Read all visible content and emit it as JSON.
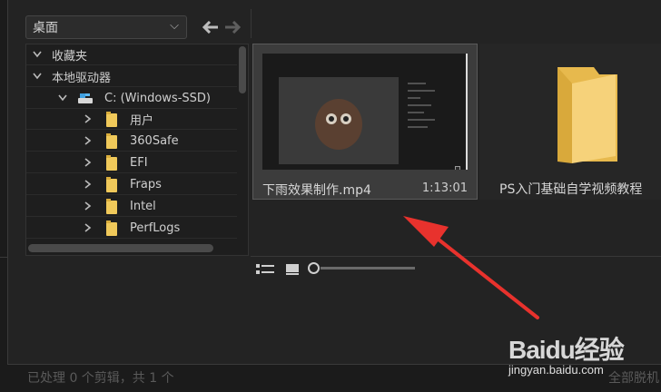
{
  "toolbar": {
    "location": "桌面",
    "dropdown_icon": "chevron-down-icon",
    "back_icon": "arrow-left-icon",
    "forward_icon": "arrow-right-icon"
  },
  "tree": {
    "items": [
      {
        "label": "收藏夹",
        "expanded": true,
        "level": 0
      },
      {
        "label": "本地驱动器",
        "expanded": true,
        "level": 0
      },
      {
        "label": "C: (Windows-SSD)",
        "expanded": true,
        "level": 1,
        "icon": "drive-icon"
      },
      {
        "label": "用户",
        "expanded": false,
        "level": 2,
        "icon": "folder-icon"
      },
      {
        "label": "360Safe",
        "expanded": false,
        "level": 2,
        "icon": "folder-icon"
      },
      {
        "label": "EFI",
        "expanded": false,
        "level": 2,
        "icon": "folder-icon"
      },
      {
        "label": "Fraps",
        "expanded": false,
        "level": 2,
        "icon": "folder-icon"
      },
      {
        "label": "Intel",
        "expanded": false,
        "level": 2,
        "icon": "folder-icon"
      },
      {
        "label": "PerfLogs",
        "expanded": false,
        "level": 2,
        "icon": "folder-icon"
      }
    ]
  },
  "media": {
    "video": {
      "name": "下雨效果制作.mp4",
      "duration": "1:13:01",
      "playhead": 0.94
    },
    "folder": {
      "name": "PS入门基础自学视频教程"
    }
  },
  "status": {
    "left": "已处理 0 个剪辑，共 1 个",
    "right": "全部脱机"
  },
  "watermark": {
    "logo": "Baidu经验",
    "url": "jingyan.baidu.com"
  },
  "colors": {
    "accent": "#3f84b5",
    "folder": "#f0c95a",
    "annotation": "#e8322d"
  }
}
